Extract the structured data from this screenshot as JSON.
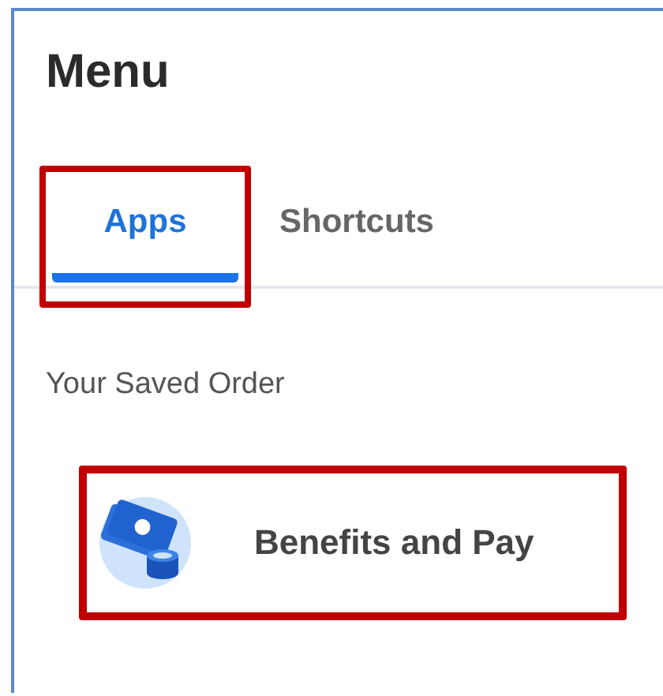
{
  "title": "Menu",
  "tabs": [
    {
      "label": "Apps",
      "selected": true,
      "highlighted": true
    },
    {
      "label": "Shortcuts",
      "selected": false,
      "highlighted": false
    }
  ],
  "section_label": "Your Saved Order",
  "apps": [
    {
      "label": "Benefits and Pay",
      "highlighted": true
    }
  ]
}
